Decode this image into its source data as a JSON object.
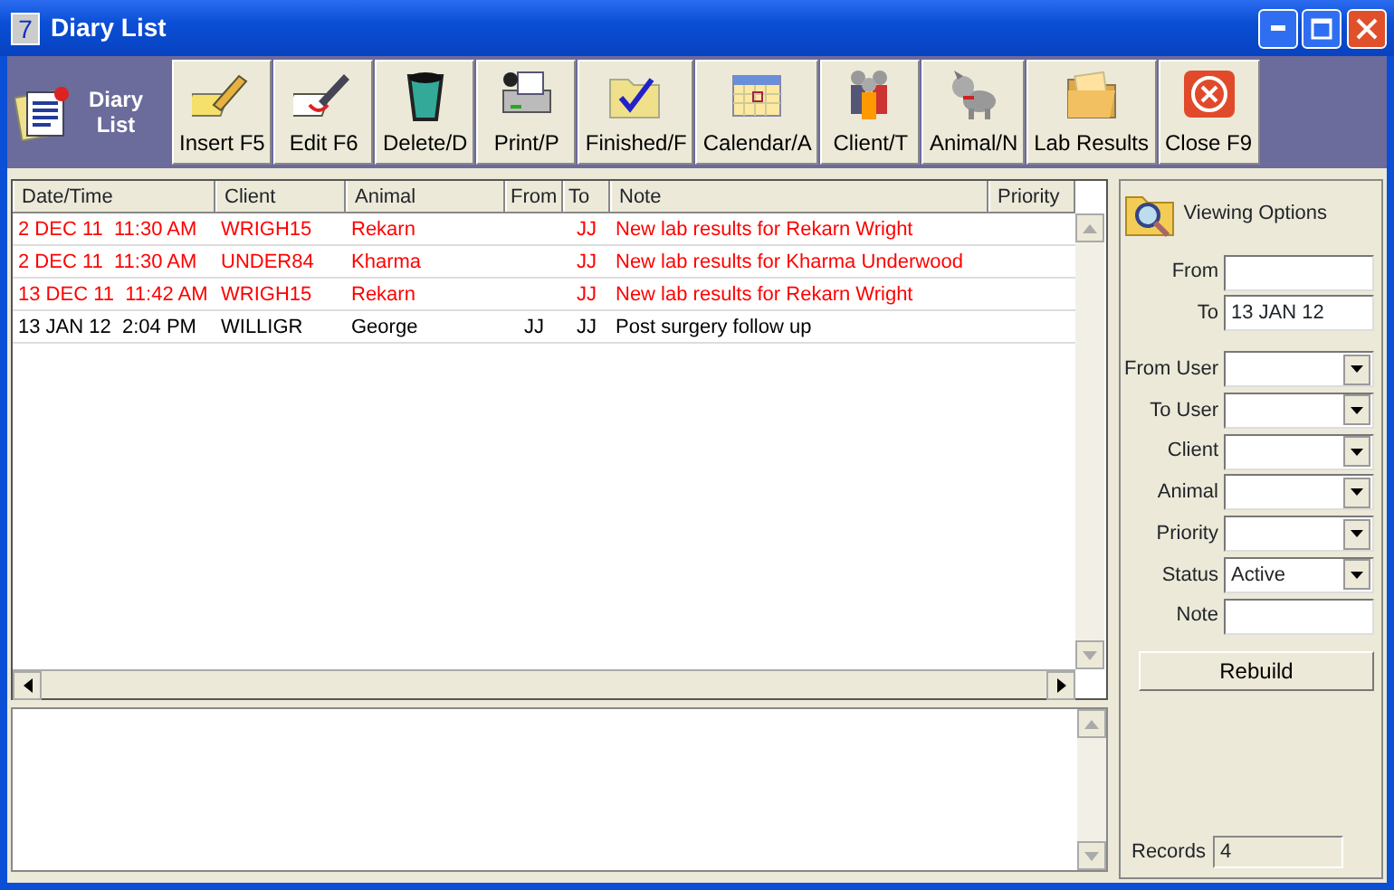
{
  "window": {
    "title": "Diary List",
    "app_icon": "7"
  },
  "toolbar": {
    "logo": "Diary List",
    "buttons": [
      {
        "label": "Insert F5"
      },
      {
        "label": "Edit F6"
      },
      {
        "label": "Delete/D"
      },
      {
        "label": "Print/P"
      },
      {
        "label": "Finished/F"
      },
      {
        "label": "Calendar/A"
      },
      {
        "label": "Client/T"
      },
      {
        "label": "Animal/N"
      },
      {
        "label": "Lab Results"
      },
      {
        "label": "Close F9"
      }
    ]
  },
  "table": {
    "columns": [
      "Date/Time",
      "Client",
      "Animal",
      "From",
      "To",
      "Note",
      "Priority"
    ],
    "rows": [
      {
        "color": "#ff0000",
        "cells": [
          "2 DEC 11  11:30 AM",
          "WRIGH15",
          "Rekarn",
          null,
          "JJ",
          "New lab results for Rekarn Wright",
          null
        ]
      },
      {
        "color": "#ff0000",
        "cells": [
          "2 DEC 11  11:30 AM",
          "UNDER84",
          "Kharma",
          null,
          "JJ",
          "New lab results for Kharma Underwood",
          null
        ]
      },
      {
        "color": "#ff0000",
        "cells": [
          "13 DEC 11  11:42 AM",
          "WRIGH15",
          "Rekarn",
          null,
          "JJ",
          "New lab results for Rekarn Wright",
          null
        ]
      },
      {
        "color": "#000000",
        "cells": [
          "13 JAN 12  2:04 PM",
          "WILLIGR",
          "George",
          "JJ",
          "JJ",
          "Post surgery follow up",
          null
        ]
      }
    ]
  },
  "viewing_options": {
    "title": "Viewing Options",
    "fields": [
      {
        "label": "From",
        "kind": "text"
      },
      {
        "label": "To",
        "kind": "text",
        "value": "13 JAN 12"
      },
      {
        "label": "From User",
        "kind": "select"
      },
      {
        "label": "To User",
        "kind": "select"
      },
      {
        "label": "Client",
        "kind": "select"
      },
      {
        "label": "Animal",
        "kind": "select"
      },
      {
        "label": "Priority",
        "kind": "select"
      },
      {
        "label": "Status",
        "kind": "select",
        "value": "Active"
      },
      {
        "label": "Note",
        "kind": "text"
      }
    ],
    "button": "Rebuild",
    "records_label": "Records",
    "records": "4"
  }
}
